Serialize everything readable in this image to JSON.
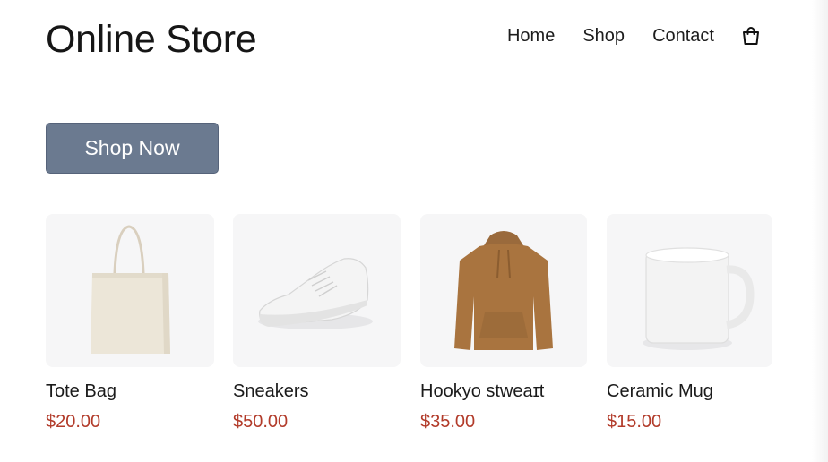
{
  "header": {
    "brand": "Online Store",
    "nav": [
      "Home",
      "Shop",
      "Contact"
    ],
    "cart_icon": "shopping-bag-icon"
  },
  "hero": {
    "cta_label": "Shop Now"
  },
  "colors": {
    "cta_bg": "#6b7a90",
    "price": "#b23b2a",
    "thumb_bg": "#f6f6f7"
  },
  "products": [
    {
      "name": "Tote Bag",
      "price": "$20.00",
      "image": "tote-bag-image"
    },
    {
      "name": "Sneakers",
      "price": "$50.00",
      "image": "sneakers-image"
    },
    {
      "name": "Hookyo stweaɪt",
      "price": "$35.00",
      "image": "hoodie-image"
    },
    {
      "name": "Ceramic Mug",
      "price": "$15.00",
      "image": "mug-image"
    }
  ]
}
